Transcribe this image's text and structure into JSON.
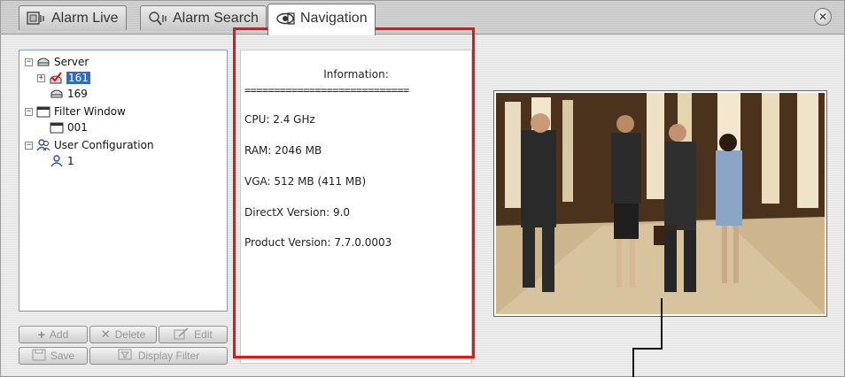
{
  "tabs": [
    {
      "label": "Alarm Live",
      "icon": "alarm-live-icon",
      "active": false
    },
    {
      "label": "Alarm Search",
      "icon": "alarm-search-icon",
      "active": false
    },
    {
      "label": "Navigation",
      "icon": "eye-icon",
      "active": true
    }
  ],
  "close_icon": "close-icon",
  "tree": {
    "server_label": "Server",
    "server_children": [
      {
        "label": "161",
        "selected": true
      },
      {
        "label": "169",
        "selected": false
      }
    ],
    "filter_window_label": "Filter Window",
    "filter_children": [
      {
        "label": "001"
      }
    ],
    "user_config_label": "User Configuration",
    "user_children": [
      {
        "label": "1"
      }
    ]
  },
  "buttons": {
    "add": "Add",
    "delete": "Delete",
    "edit": "Edit",
    "save": "Save",
    "display_filter": "Display Filter"
  },
  "info": {
    "title": "Information:",
    "separator": "============================",
    "cpu": "CPU: 2.4 GHz",
    "ram": "RAM: 2046 MB",
    "vga": "VGA: 512 MB (411 MB)",
    "directx": "DirectX Version: 9.0",
    "product": "Product Version: 7.7.0.0003"
  },
  "colors": {
    "highlight": "#ee1111",
    "selection": "#316ac5"
  }
}
